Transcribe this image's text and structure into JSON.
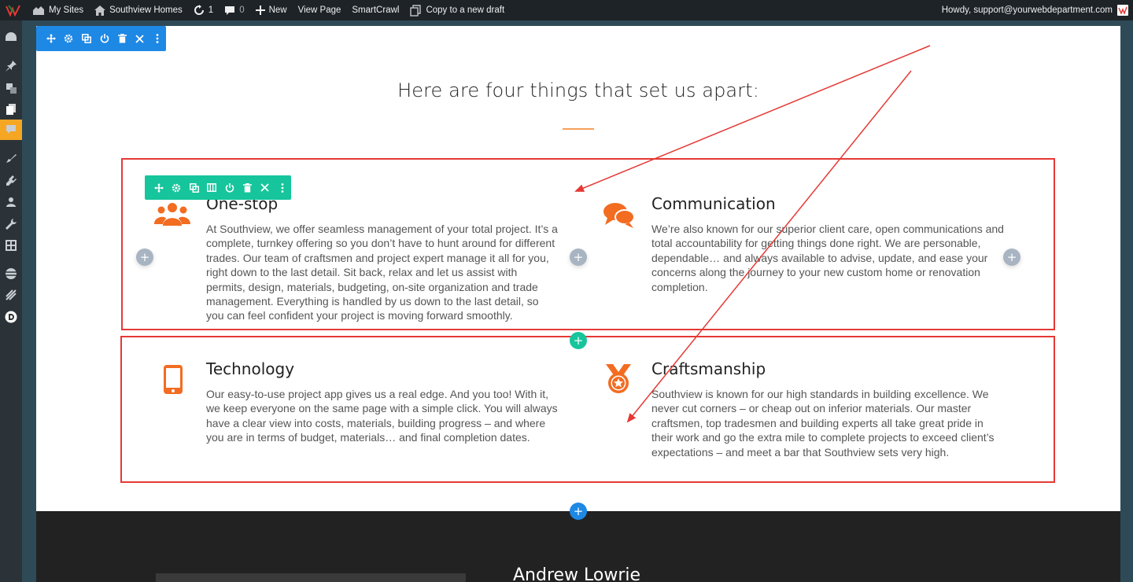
{
  "adminbar": {
    "my_sites": "My Sites",
    "site_name": "Southview Homes",
    "updates_count": "1",
    "comments_count": "0",
    "new_label": "New",
    "view_page": "View Page",
    "smartcrawl": "SmartCrawl",
    "copy_draft": "Copy to a new draft",
    "howdy": "Howdy, support@yourwebdepartment.com"
  },
  "page": {
    "heading": "Here are four things that set us apart:",
    "features": [
      {
        "title": "One-stop",
        "icon": "users-icon",
        "text": "At Southview, we offer seamless management of your total project. It’s a complete, turnkey offering so you don’t have to hunt around for different trades. Our team of craftsmen and project expert manage it all for you, right down to the last detail. Sit back, relax and let us assist with permits, design, materials, budgeting, on-site organization and trade management. Everything is handled by us down to the last detail, so you can feel confident your project is moving forward smoothly."
      },
      {
        "title": "Communication",
        "icon": "chat-bubbles-icon",
        "text": "We’re also known for our superior client care, open communications and total accountability for getting things done right.  We are personable, dependable… and always available to advise, update, and ease your concerns along the journey to your new custom home or renovation completion."
      },
      {
        "title": "Technology",
        "icon": "mobile-phone-icon",
        "text": "Our easy-to-use project app gives us a real edge. And you too!  With it, we keep everyone on the same page with a simple click. You will always have a clear view into costs, materials, building progress – and where you are in terms of budget, materials… and final completion dates."
      },
      {
        "title": "Craftsmanship",
        "icon": "award-medal-icon",
        "text": "Southview is known for our high standards in building excellence. We never cut corners – or cheap out on inferior materials. Our master craftsmen, top tradesmen and building experts all take great pride in their work and go the extra mile to complete projects to exceed client’s expectations – and meet a bar that Southview sets very high."
      }
    ],
    "person_name": "Andrew Lowrie",
    "plus_symbol": "+"
  },
  "colors": {
    "accent_orange": "#f26c21",
    "builder_blue": "#1e88e5",
    "builder_teal": "#16c59b",
    "annotation_red": "#e53935"
  }
}
